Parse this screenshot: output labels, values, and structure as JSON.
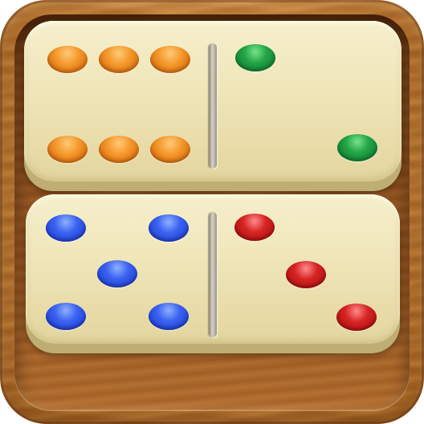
{
  "app_icon": {
    "theme": "wooden-tray",
    "colors": {
      "wood": "#c07a34",
      "domino_face": "#f3ebc4",
      "orange_pip": "#f59a2e",
      "green_pip": "#23a546",
      "blue_pip": "#3a62f0",
      "red_pip": "#d62424"
    }
  },
  "dominoes": [
    {
      "name": "top-domino",
      "left_value": 6,
      "right_value": 2,
      "left_color": "orange",
      "right_color": "green"
    },
    {
      "name": "bottom-domino",
      "left_value": 5,
      "right_value": 3,
      "left_color": "blue",
      "right_color": "red"
    }
  ]
}
